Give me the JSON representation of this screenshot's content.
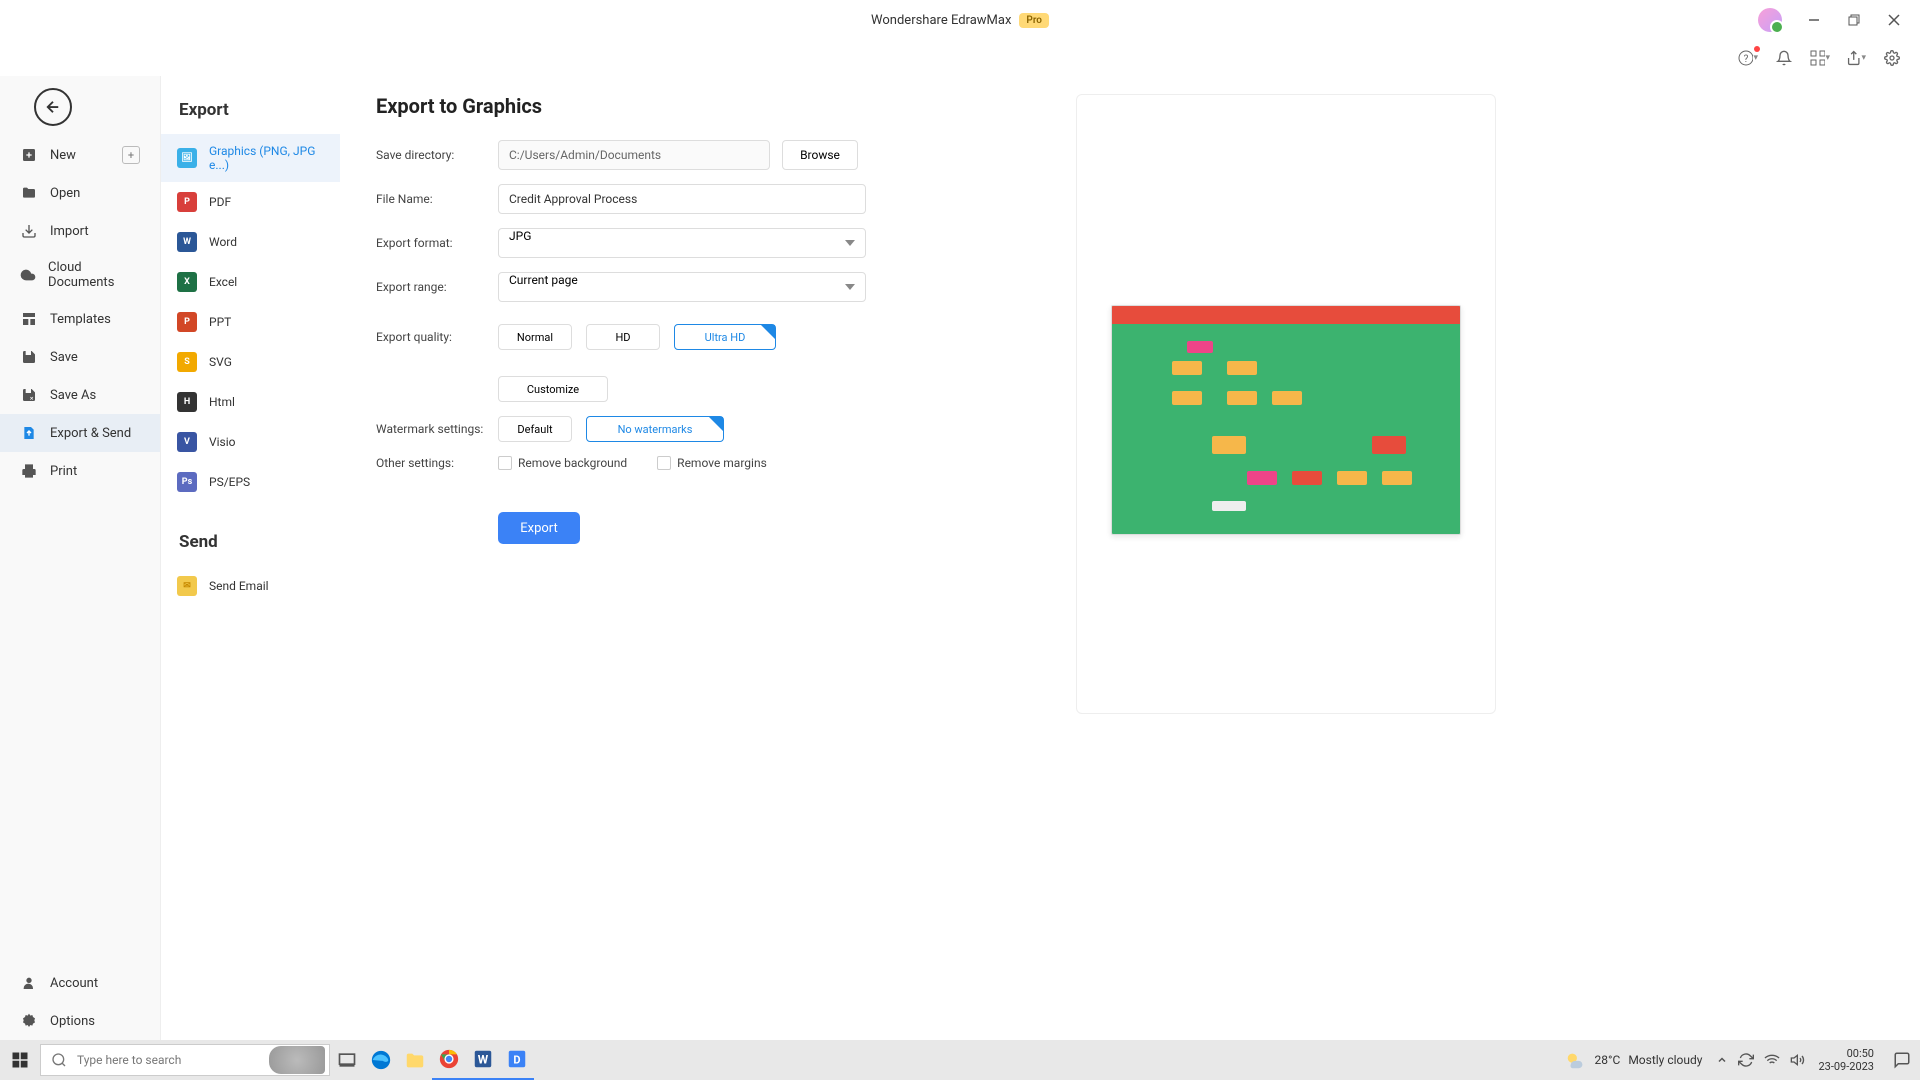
{
  "titlebar": {
    "app_name": "Wondershare EdrawMax",
    "badge": "Pro"
  },
  "sidebar_left": {
    "items": [
      {
        "label": "New",
        "icon": "plus-square",
        "has_add": true
      },
      {
        "label": "Open",
        "icon": "folder"
      },
      {
        "label": "Import",
        "icon": "download"
      },
      {
        "label": "Cloud Documents",
        "icon": "cloud"
      },
      {
        "label": "Templates",
        "icon": "template"
      },
      {
        "label": "Save",
        "icon": "save"
      },
      {
        "label": "Save As",
        "icon": "save-as"
      },
      {
        "label": "Export & Send",
        "icon": "export",
        "active": true
      },
      {
        "label": "Print",
        "icon": "printer"
      }
    ],
    "bottom": [
      {
        "label": "Account",
        "icon": "user"
      },
      {
        "label": "Options",
        "icon": "gear"
      }
    ]
  },
  "sidebar_mid": {
    "export_title": "Export",
    "send_title": "Send",
    "export_types": [
      {
        "label": "Graphics (PNG, JPG e...)",
        "icon_bg": "#3ab0e8",
        "icon_txt": "IMG",
        "active": true
      },
      {
        "label": "PDF",
        "icon_bg": "#d83f3b",
        "icon_txt": "PDF"
      },
      {
        "label": "Word",
        "icon_bg": "#2b5797",
        "icon_txt": "W"
      },
      {
        "label": "Excel",
        "icon_bg": "#1e7145",
        "icon_txt": "X"
      },
      {
        "label": "PPT",
        "icon_bg": "#d24726",
        "icon_txt": "P"
      },
      {
        "label": "SVG",
        "icon_bg": "#f2a900",
        "icon_txt": "SVG"
      },
      {
        "label": "Html",
        "icon_bg": "#333",
        "icon_txt": "H"
      },
      {
        "label": "Visio",
        "icon_bg": "#3955a3",
        "icon_txt": "V"
      },
      {
        "label": "PS/EPS",
        "icon_bg": "#5c6bc0",
        "icon_txt": "PS"
      }
    ],
    "send_types": [
      {
        "label": "Send Email",
        "icon_bg": "#f2c94c",
        "icon_txt": "✉"
      }
    ]
  },
  "form": {
    "title": "Export to Graphics",
    "save_dir_label": "Save directory:",
    "save_dir_value": "C:/Users/Admin/Documents",
    "browse_label": "Browse",
    "file_name_label": "File Name:",
    "file_name_value": "Credit Approval Process",
    "format_label": "Export format:",
    "format_value": "JPG",
    "range_label": "Export range:",
    "range_value": "Current page",
    "quality_label": "Export quality:",
    "quality_normal": "Normal",
    "quality_hd": "HD",
    "quality_uhd": "Ultra HD",
    "customize_label": "Customize",
    "watermark_label": "Watermark settings:",
    "watermark_default": "Default",
    "watermark_none": "No watermarks",
    "other_label": "Other settings:",
    "remove_bg": "Remove background",
    "remove_margins": "Remove margins",
    "export_btn": "Export"
  },
  "taskbar": {
    "search_placeholder": "Type here to search",
    "temp": "28°C",
    "weather": "Mostly cloudy",
    "time": "00:50",
    "date": "23-09-2023"
  }
}
